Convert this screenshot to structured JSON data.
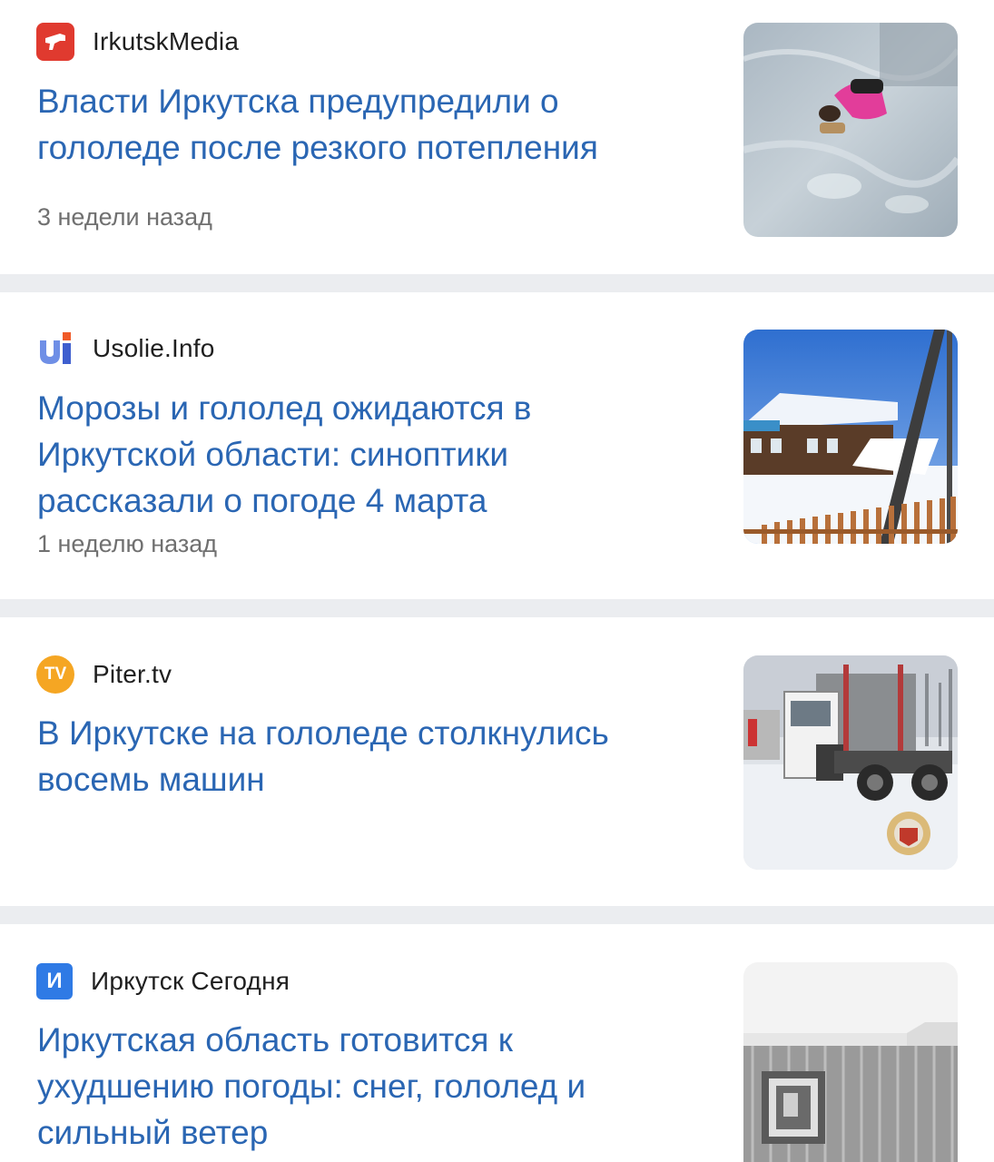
{
  "items": [
    {
      "source": "IrkutskMedia",
      "logo_icon": "megaphone-icon",
      "logo_color": "#e03a2f",
      "title_line1": "Власти Иркутска предупредили о",
      "title_line2": "гололеде после резкого потепления",
      "title_line3": "",
      "time": "3 недели назад",
      "image": "person-fallen-on-ice-photo"
    },
    {
      "source": "Usolie.Info",
      "logo_icon": "ui-logo-icon",
      "logo_color": "#4a6fd8",
      "title_line1": "Морозы и гололед ожидаются в",
      "title_line2": "Иркутской области: синоптики",
      "title_line3": "рассказали о погоде 4 марта",
      "time": "1 неделю назад",
      "image": "snowy-village-house-photo"
    },
    {
      "source": "Piter.tv",
      "logo_icon": "tv-logo-icon",
      "logo_color": "#f5a623",
      "title_line1": "В Иркутске на гололеде столкнулись",
      "title_line2": "восемь машин",
      "title_line3": "",
      "time": "",
      "image": "trucks-collision-on-snow-photo"
    },
    {
      "source": "Иркутск Сегодня",
      "logo_icon": "letter-i-logo-icon",
      "logo_color": "#2f7ae5",
      "title_line1": "Иркутская область готовится к",
      "title_line2": "ухудшению погоды: снег, гололед и",
      "title_line3": "сильный ветер",
      "time": "",
      "image": "snowfall-building-photo"
    }
  ]
}
